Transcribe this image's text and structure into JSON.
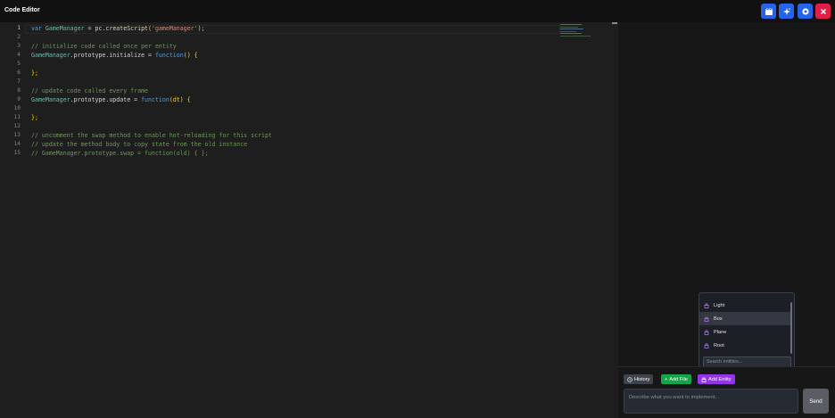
{
  "window": {
    "title": "Code Editor"
  },
  "toolbar": {
    "buttons": [
      {
        "name": "game-button",
        "icon": "clapperboard-icon",
        "color": "#2563eb"
      },
      {
        "name": "assistant-button",
        "icon": "sparkle-icon",
        "color": "#2563eb"
      },
      {
        "name": "settings-button",
        "icon": "gear-icon",
        "color": "#2563eb"
      },
      {
        "name": "close-button",
        "icon": "close-icon",
        "color": "#e11d48"
      }
    ]
  },
  "editor": {
    "line_numbers": [
      "1",
      "2",
      "3",
      "4",
      "5",
      "6",
      "7",
      "8",
      "9",
      "10",
      "11",
      "12",
      "13",
      "14",
      "15"
    ],
    "lines": [
      {
        "a": "var ",
        "b": "GameManager",
        "c": " = pc.",
        "d": "createScript",
        "e": "(",
        "f": "'gameManager'",
        "g": ");"
      },
      {
        "a": ""
      },
      {
        "comment": "// initialize code called once per entity"
      },
      {
        "a": "GameManager",
        "b": ".prototype.initialize = ",
        "c": "function",
        "d": "() {"
      },
      {
        "a": ""
      },
      {
        "a": "};"
      },
      {
        "a": ""
      },
      {
        "comment": "// update code called every frame"
      },
      {
        "a": "GameManager",
        "b": ".prototype.update = ",
        "c": "function",
        "d": "(dt) {"
      },
      {
        "a": ""
      },
      {
        "a": "};"
      },
      {
        "a": ""
      },
      {
        "comment": "// uncomment the swap method to enable hot-reloading for this script"
      },
      {
        "comment": "// update the method body to copy state from the old instance"
      },
      {
        "comment": "// GameManager.prototype.swap = function(old) { };"
      }
    ]
  },
  "entity_dropdown": {
    "items": [
      "Light",
      "Box",
      "Plane",
      "Root"
    ],
    "selected": "Box",
    "search_placeholder": "Search entities..."
  },
  "chat": {
    "history_label": "History",
    "add_file_label": "Add File",
    "add_entity_label": "Add Entity",
    "input_placeholder": "Describe what you want to implement...",
    "send_label": "Send",
    "colors": {
      "history": "#3f434b",
      "add_file": "#16a34a",
      "add_entity": "#9333ea",
      "send": "#5a5d63"
    }
  }
}
